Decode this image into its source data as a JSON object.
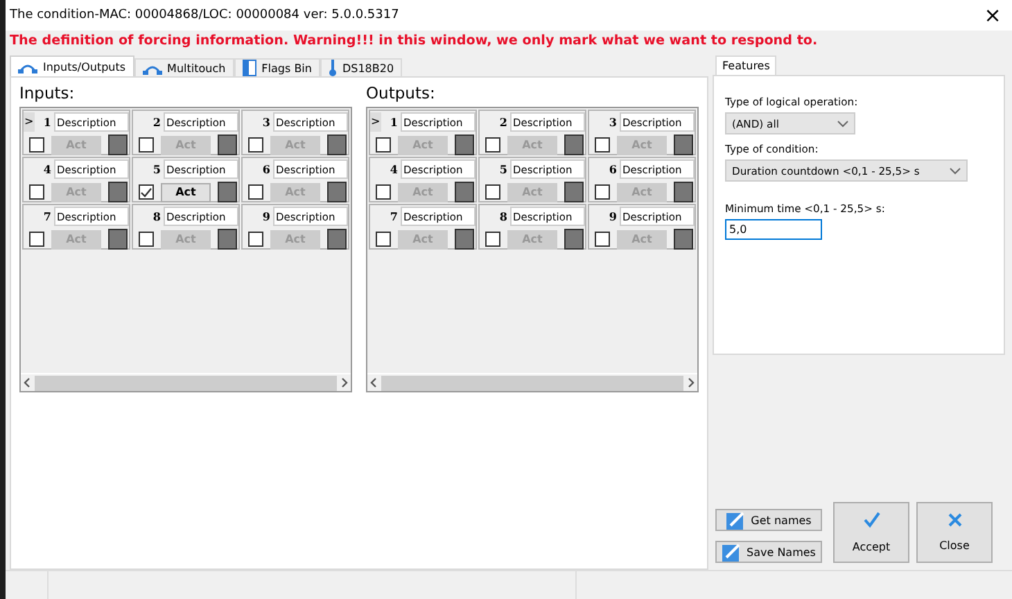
{
  "window": {
    "title": "The condition-MAC: 00004868/LOC: 00000084 ver: 5.0.0.5317",
    "close": "×"
  },
  "warning": "The definition of forcing information. Warning!!! in this window, we only mark what we want to respond to.",
  "tabs": [
    {
      "label": "Inputs/Outputs",
      "selected": true,
      "kind": "io"
    },
    {
      "label": "Multitouch",
      "selected": false,
      "kind": "io"
    },
    {
      "label": "Flags Bin",
      "selected": false,
      "kind": "flags"
    },
    {
      "label": "DS18B20",
      "selected": false,
      "kind": "temp"
    }
  ],
  "grids": [
    {
      "title": "Inputs:",
      "row_marker": ">",
      "cells": [
        {
          "number": "1",
          "description": "Description",
          "checked": false,
          "act": "Act"
        },
        {
          "number": "2",
          "description": "Description",
          "checked": false,
          "act": "Act"
        },
        {
          "number": "3",
          "description": "Description",
          "checked": false,
          "act": "Act"
        },
        {
          "number": "4",
          "description": "Description",
          "checked": false,
          "act": "Act"
        },
        {
          "number": "5",
          "description": "Description",
          "checked": true,
          "act": "Act"
        },
        {
          "number": "6",
          "description": "Description",
          "checked": false,
          "act": "Act"
        },
        {
          "number": "7",
          "description": "Description",
          "checked": false,
          "act": "Act"
        },
        {
          "number": "8",
          "description": "Description",
          "checked": false,
          "act": "Act"
        },
        {
          "number": "9",
          "description": "Description",
          "checked": false,
          "act": "Act"
        }
      ]
    },
    {
      "title": "Outputs:",
      "row_marker": ">",
      "cells": [
        {
          "number": "1",
          "description": "Description",
          "checked": false,
          "act": "Act"
        },
        {
          "number": "2",
          "description": "Description",
          "checked": false,
          "act": "Act"
        },
        {
          "number": "3",
          "description": "Description",
          "checked": false,
          "act": "Act"
        },
        {
          "number": "4",
          "description": "Description",
          "checked": false,
          "act": "Act"
        },
        {
          "number": "5",
          "description": "Description",
          "checked": false,
          "act": "Act"
        },
        {
          "number": "6",
          "description": "Description",
          "checked": false,
          "act": "Act"
        },
        {
          "number": "7",
          "description": "Description",
          "checked": false,
          "act": "Act"
        },
        {
          "number": "8",
          "description": "Description",
          "checked": false,
          "act": "Act"
        },
        {
          "number": "9",
          "description": "Description",
          "checked": false,
          "act": "Act"
        }
      ]
    }
  ],
  "features": {
    "tab": "Features",
    "logic_label": "Type of logical operation:",
    "logic_value": "(AND) all",
    "condition_label": "Type of condition:",
    "condition_value": "Duration countdown <0,1 - 25,5> s",
    "time_label": "Minimum time <0,1 - 25,5> s:",
    "time_value": "5,0"
  },
  "buttons": [
    {
      "label": "Get names",
      "kind": "small"
    },
    {
      "label": "Save Names",
      "kind": "small"
    },
    {
      "label": "Accept",
      "kind": "accept"
    },
    {
      "label": "Close",
      "kind": "close"
    }
  ]
}
